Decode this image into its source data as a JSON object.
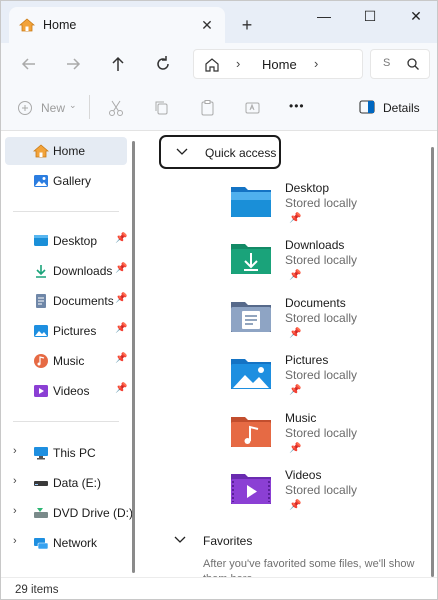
{
  "window": {
    "tab_title": "Home",
    "tab_close": "✕",
    "new_tab": "+",
    "minimize": "—",
    "maximize": "☐",
    "close": "✕"
  },
  "address": {
    "crumb": "Home",
    "chevron": "›",
    "search_placeholder": "S"
  },
  "commands": {
    "new_label": "New",
    "details_label": "Details",
    "more": "•••"
  },
  "sidebar": {
    "items": [
      {
        "label": "Home",
        "icon": "home-icon"
      },
      {
        "label": "Gallery",
        "icon": "gallery-icon"
      },
      {
        "label": "Desktop",
        "icon": "desktop-icon"
      },
      {
        "label": "Downloads",
        "icon": "downloads-icon"
      },
      {
        "label": "Documents",
        "icon": "documents-icon"
      },
      {
        "label": "Pictures",
        "icon": "pictures-icon"
      },
      {
        "label": "Music",
        "icon": "music-icon"
      },
      {
        "label": "Videos",
        "icon": "videos-icon"
      },
      {
        "label": "This PC",
        "icon": "pc-icon"
      },
      {
        "label": "Data (E:)",
        "icon": "drive-icon"
      },
      {
        "label": "DVD Drive (D:)",
        "icon": "dvd-icon"
      },
      {
        "label": "Network",
        "icon": "network-icon"
      }
    ]
  },
  "main": {
    "quick_access_title": "Quick access",
    "favorites_title": "Favorites",
    "favorites_text": "After you've favorited some files, we'll show them here.",
    "folders": [
      {
        "name": "Desktop",
        "status": "Stored locally",
        "icon": "desktop-folder-icon",
        "color": "#1a8fd8"
      },
      {
        "name": "Downloads",
        "status": "Stored locally",
        "icon": "downloads-folder-icon",
        "color": "#1aa37a"
      },
      {
        "name": "Documents",
        "status": "Stored locally",
        "icon": "documents-folder-icon",
        "color": "#6f87a8"
      },
      {
        "name": "Pictures",
        "status": "Stored locally",
        "icon": "pictures-folder-icon",
        "color": "#1e8fe0"
      },
      {
        "name": "Music",
        "status": "Stored locally",
        "icon": "music-folder-icon",
        "color": "#e66a44"
      },
      {
        "name": "Videos",
        "status": "Stored locally",
        "icon": "videos-folder-icon",
        "color": "#8b3fd4"
      }
    ]
  },
  "status": {
    "items_count": "29 items"
  },
  "colors": {
    "titlebar": "#e8eef7",
    "selected": "#e5ebf3",
    "accent": "#0067c0"
  }
}
